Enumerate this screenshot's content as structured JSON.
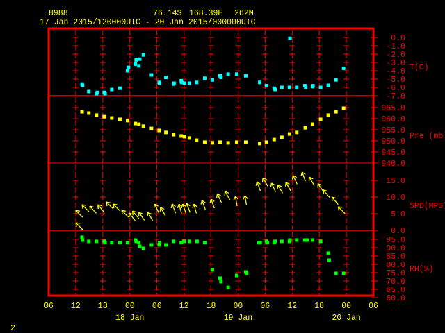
{
  "header": {
    "station": "8988",
    "lat": "76.14S",
    "lon": "168.39E",
    "elev": "262M",
    "period": "17 Jan 2015/120000UTC - 20 Jan 2015/000000UTC"
  },
  "page_number": "2",
  "chart_data": {
    "type": "scatter",
    "x_units": "hours since 17 Jan 2015 06 UTC",
    "xlim": [
      0,
      72
    ],
    "x_tick_labels": [
      "06",
      "12",
      "18",
      "00",
      "06",
      "12",
      "18",
      "00",
      "06",
      "12",
      "18",
      "00",
      "06"
    ],
    "date_labels": [
      {
        "label": "18 Jan",
        "hour": 18
      },
      {
        "label": "19 Jan",
        "hour": 42
      },
      {
        "label": "20 Jan",
        "hour": 66
      }
    ],
    "panels": [
      {
        "name": "temperature",
        "label": "T(C)",
        "color": "#00ffff",
        "ylim": [
          -7,
          0
        ],
        "tick_labels": [
          "0.0",
          "-1.0",
          "-2.0",
          "-3.0",
          "-4.0",
          "-5.0",
          "-6.0",
          "-7.0"
        ],
        "ticks": [
          0,
          -1,
          -2,
          -3,
          -4,
          -5,
          -6,
          -7
        ],
        "points": [
          [
            7.4,
            -5.6
          ],
          [
            7.5,
            -5.75
          ],
          [
            8.9,
            -6.5
          ],
          [
            10.6,
            -6.75
          ],
          [
            10.8,
            -6.6
          ],
          [
            12.3,
            -6.6
          ],
          [
            12.5,
            -6.75
          ],
          [
            14,
            -6.25
          ],
          [
            15.8,
            -6.1
          ],
          [
            17.5,
            -4.0
          ],
          [
            17.7,
            -3.6
          ],
          [
            19.2,
            -3.2
          ],
          [
            19.4,
            -2.7
          ],
          [
            20,
            -3.4
          ],
          [
            20.2,
            -2.6
          ],
          [
            21,
            -2.1
          ],
          [
            22.8,
            -4.5
          ],
          [
            24.5,
            -5.4
          ],
          [
            24.6,
            -5.5
          ],
          [
            26,
            -4.8
          ],
          [
            27.7,
            -5.6
          ],
          [
            27.8,
            -5.5
          ],
          [
            29.4,
            -5.2
          ],
          [
            29.5,
            -5.4
          ],
          [
            30.1,
            -5.5
          ],
          [
            31.2,
            -5.5
          ],
          [
            32.8,
            -5.4
          ],
          [
            34.6,
            -4.9
          ],
          [
            36.3,
            -5.1
          ],
          [
            38,
            -4.6
          ],
          [
            38.2,
            -4.8
          ],
          [
            39.8,
            -4.4
          ],
          [
            41.7,
            -4.4
          ],
          [
            43.7,
            -4.6
          ],
          [
            46.8,
            -5.4
          ],
          [
            48.3,
            -5.8
          ],
          [
            50,
            -6.1
          ],
          [
            50.2,
            -6.25
          ],
          [
            51.7,
            -6.0
          ],
          [
            53.4,
            -6.0
          ],
          [
            53.5,
            -0.1
          ],
          [
            55,
            -6.0
          ],
          [
            56.8,
            -5.8
          ],
          [
            57,
            -6.0
          ],
          [
            58.5,
            -5.9
          ],
          [
            58.6,
            -5.8
          ],
          [
            60.3,
            -6.0
          ],
          [
            62,
            -5.75
          ],
          [
            63.7,
            -5.1
          ],
          [
            65.4,
            -3.7
          ]
        ]
      },
      {
        "name": "pressure",
        "label": "Pre (mb)",
        "color": "#ffff00",
        "ylim": [
          940,
          965
        ],
        "tick_labels": [
          "965.0",
          "960.0",
          "955.0",
          "950.0",
          "945.0",
          "940.0"
        ],
        "ticks": [
          965,
          960,
          955,
          950,
          945,
          940
        ],
        "points": [
          [
            7.4,
            963.1
          ],
          [
            8.9,
            962.5
          ],
          [
            10.6,
            961.6
          ],
          [
            12.3,
            960.9
          ],
          [
            14,
            960.3
          ],
          [
            15.8,
            959.7
          ],
          [
            17.5,
            959.1
          ],
          [
            19.2,
            957.8
          ],
          [
            20,
            957.5
          ],
          [
            21,
            956.6
          ],
          [
            22.8,
            955.6
          ],
          [
            24.5,
            954.7
          ],
          [
            26,
            953.8
          ],
          [
            27.7,
            952.8
          ],
          [
            29.4,
            952.2
          ],
          [
            30.1,
            951.9
          ],
          [
            31.2,
            951.3
          ],
          [
            32.8,
            950.3
          ],
          [
            34.6,
            949.4
          ],
          [
            36.3,
            949.1
          ],
          [
            38,
            949.4
          ],
          [
            39.8,
            949.1
          ],
          [
            41.7,
            949.4
          ],
          [
            43.7,
            949.4
          ],
          [
            46.8,
            948.8
          ],
          [
            48.3,
            949.4
          ],
          [
            50,
            950.6
          ],
          [
            51.7,
            951.6
          ],
          [
            53.4,
            953.1
          ],
          [
            55,
            953.8
          ],
          [
            56.9,
            955.9
          ],
          [
            58.5,
            957.5
          ],
          [
            60.3,
            959.7
          ],
          [
            62,
            961.6
          ],
          [
            63.7,
            963.1
          ],
          [
            65.4,
            964.7
          ]
        ]
      },
      {
        "name": "wind",
        "label": "SPD(MPS)",
        "color": "#ffff00",
        "ylim": [
          0,
          15
        ],
        "tick_labels": [
          "15.0",
          "10.0",
          "5.0",
          "0.0"
        ],
        "ticks": [
          15,
          10,
          5,
          0
        ],
        "points_hour_speed_heading": [
          [
            6,
            6.0,
            315
          ],
          [
            6,
            2.3,
            315
          ],
          [
            7.4,
            7.7,
            315
          ],
          [
            9.1,
            7.3,
            318
          ],
          [
            10.9,
            7.7,
            320
          ],
          [
            12.8,
            8.5,
            315
          ],
          [
            14.3,
            7.9,
            315
          ],
          [
            16.2,
            6.0,
            315
          ],
          [
            17.8,
            5.2,
            320
          ],
          [
            18.6,
            5.8,
            320
          ],
          [
            20,
            5.4,
            325
          ],
          [
            22,
            5.4,
            330
          ],
          [
            23.5,
            7.9,
            335
          ],
          [
            24.8,
            6.9,
            330
          ],
          [
            27.4,
            7.9,
            340
          ],
          [
            28.9,
            7.9,
            345
          ],
          [
            29.7,
            7.9,
            340
          ],
          [
            30.6,
            8.1,
            340
          ],
          [
            32.2,
            7.9,
            345
          ],
          [
            34,
            9.0,
            340
          ],
          [
            36,
            9.4,
            340
          ],
          [
            37.4,
            11,
            335
          ],
          [
            39.1,
            11.7,
            330
          ],
          [
            41.4,
            10.2,
            350
          ],
          [
            43.5,
            10.4,
            350
          ],
          [
            46.2,
            14.6,
            340
          ],
          [
            47.5,
            15.8,
            330
          ],
          [
            49.4,
            14.2,
            335
          ],
          [
            50.8,
            13.7,
            330
          ],
          [
            52.6,
            14.4,
            330
          ],
          [
            54.2,
            16.5,
            335
          ],
          [
            56.2,
            17.5,
            340
          ],
          [
            57.8,
            16,
            330
          ],
          [
            59.7,
            14,
            325
          ],
          [
            60.9,
            12.1,
            320
          ],
          [
            62.8,
            10,
            320
          ],
          [
            64.2,
            7.1,
            315
          ]
        ]
      },
      {
        "name": "humidity",
        "label": "RH(%)",
        "color": "#00ff00",
        "ylim": [
          60,
          95
        ],
        "tick_labels": [
          "95.0",
          "90.0",
          "85.0",
          "80.0",
          "75.0",
          "70.0",
          "65.0",
          "60.0"
        ],
        "ticks": [
          95,
          90,
          85,
          80,
          75,
          70,
          65,
          60
        ],
        "points": [
          [
            7.4,
            96.3
          ],
          [
            7.5,
            94.6
          ],
          [
            8.9,
            93.8
          ],
          [
            10.6,
            93.8
          ],
          [
            12.3,
            93.8
          ],
          [
            12.5,
            93
          ],
          [
            14,
            93
          ],
          [
            15.8,
            93
          ],
          [
            17.5,
            93
          ],
          [
            19.2,
            94.6
          ],
          [
            19.4,
            93.8
          ],
          [
            20,
            93
          ],
          [
            20.2,
            90.8
          ],
          [
            21,
            89.6
          ],
          [
            22.8,
            91.7
          ],
          [
            24.5,
            91.7
          ],
          [
            24.6,
            93
          ],
          [
            26,
            91.7
          ],
          [
            27.7,
            93.8
          ],
          [
            29.4,
            93
          ],
          [
            30,
            93.8
          ],
          [
            31.2,
            93.8
          ],
          [
            32.9,
            93.8
          ],
          [
            34.6,
            93
          ],
          [
            36.3,
            76.7
          ],
          [
            38,
            71.7
          ],
          [
            38.2,
            69.6
          ],
          [
            39.8,
            66.2
          ],
          [
            41.7,
            73.3
          ],
          [
            43.7,
            75.4
          ],
          [
            43.9,
            74.6
          ],
          [
            46.6,
            93
          ],
          [
            46.9,
            93
          ],
          [
            48.3,
            93.8
          ],
          [
            48.5,
            93
          ],
          [
            50,
            93
          ],
          [
            50.2,
            93.8
          ],
          [
            51.7,
            93.8
          ],
          [
            53.4,
            93.8
          ],
          [
            53.5,
            94.6
          ],
          [
            55,
            94.6
          ],
          [
            56.8,
            94.6
          ],
          [
            57.3,
            94.6
          ],
          [
            58.5,
            94.6
          ],
          [
            60.3,
            93.8
          ],
          [
            62,
            86.7
          ],
          [
            62.2,
            82.5
          ],
          [
            63.7,
            74.6
          ],
          [
            65.4,
            74.6
          ]
        ]
      }
    ]
  }
}
